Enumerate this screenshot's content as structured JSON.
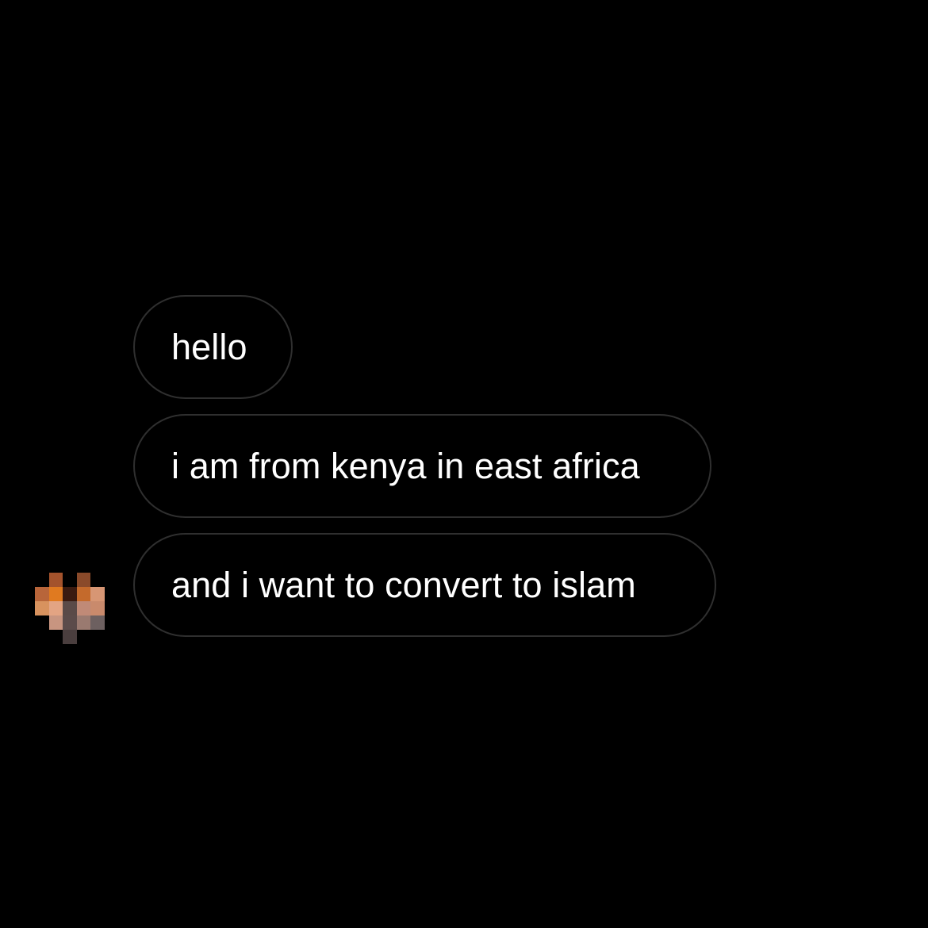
{
  "conversation": {
    "messages": [
      {
        "text": "hello"
      },
      {
        "text": "i am from kenya in east africa"
      },
      {
        "text": "and i want to convert to islam"
      }
    ],
    "sender_avatar": {
      "icon": "pixelated-avatar-icon",
      "state": "pixelated"
    }
  },
  "colors": {
    "background": "#000000",
    "bubble_border": "#2f2f2f",
    "text": "#ffffff"
  }
}
